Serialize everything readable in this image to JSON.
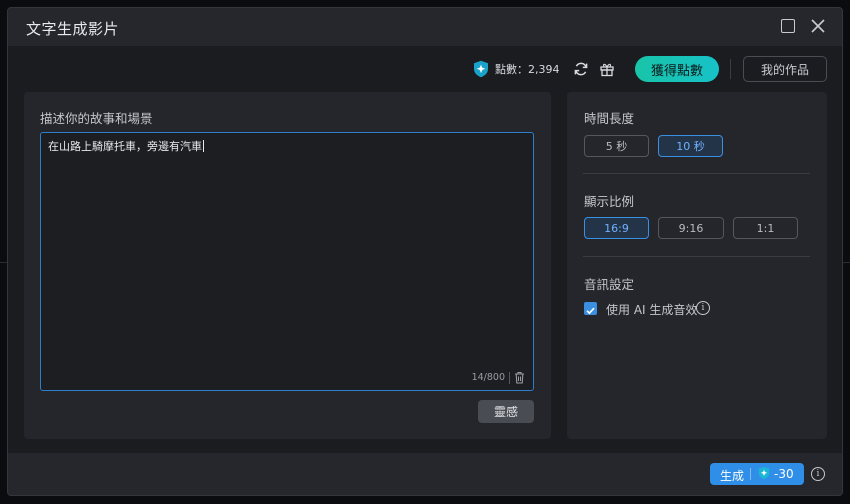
{
  "dialog": {
    "title": "文字生成影片"
  },
  "topbar": {
    "points_label": "點數：2,394",
    "get_points_label": "獲得點數",
    "my_works_label": "我的作品"
  },
  "prompt": {
    "label": "描述你的故事和場景",
    "text": "在山路上騎摩托車，旁邊有汽車",
    "counter": "14/800",
    "inspiration_label": "靈感"
  },
  "settings": {
    "duration": {
      "label": "時間長度",
      "options": [
        "5 秒",
        "10 秒"
      ],
      "selected": "10 秒"
    },
    "ratio": {
      "label": "顯示比例",
      "options": [
        "16:9",
        "9:16",
        "1:1"
      ],
      "selected": "16:9"
    },
    "audio": {
      "label": "音訊設定",
      "checkbox_label": "使用 AI 生成音效",
      "checked": true
    }
  },
  "footer": {
    "generate_label": "生成",
    "cost": "-30"
  },
  "colors": {
    "accent": "#3b8fe0",
    "primary_teal": "#19c4a8",
    "generate_blue": "#2f8fe8"
  }
}
